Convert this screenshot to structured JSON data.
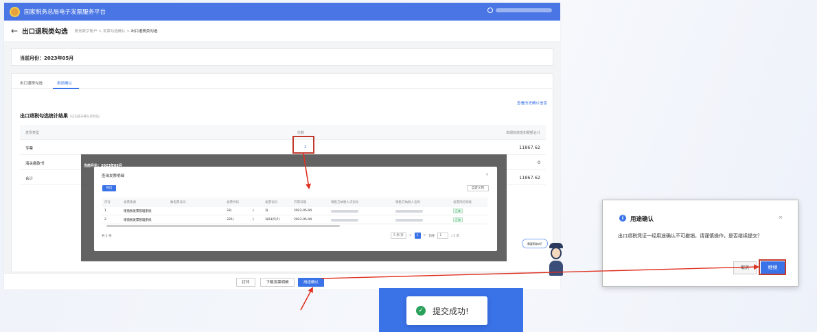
{
  "header": {
    "platform_title": "国家税务总局电子发票服务平台"
  },
  "page": {
    "back_icon": "←",
    "title": "出口退税类勾选",
    "breadcrumb": [
      "税务数字账户",
      "发票勾选确认",
      "出口退税类勾选"
    ],
    "crumb_sep": ">"
  },
  "month_label": "当前月份：2023年05月",
  "tabs": [
    "出口退税勾选",
    "用途确认"
  ],
  "history_link": "查看历史确认信息",
  "section": {
    "title": "出口退税勾选统计结果",
    "subtitle": "(已勾选未确认的凭证)"
  },
  "stats_table": {
    "headers": [
      "发票类型",
      "份数",
      "本期有效抵扣税额合计"
    ],
    "rows": [
      {
        "type": "专票",
        "count": "2",
        "amount": "11867.62"
      },
      {
        "type": "海关缴款书",
        "count": "",
        "amount": "0"
      },
      {
        "type": "合计",
        "count": "",
        "amount": "11867.62"
      }
    ]
  },
  "overlay": {
    "month": "当前月份：2023年05月"
  },
  "query_dialog": {
    "title": "查询发票明细",
    "close": "×",
    "export_label": "导出",
    "columns_label": "自定义列",
    "headers": [
      "序号",
      "发票来源",
      "数电票号码",
      "发票代码",
      "发票号码",
      "开票日期",
      "销售方纳税人识别号",
      "销售方纳税人名称",
      "发票风险等级"
    ],
    "rows": [
      {
        "no": "1",
        "source": "增值税发票管理系统",
        "code": "33(",
        "code2": ")",
        "num": "3(",
        "date": "2023-05-04",
        "status": "正常"
      },
      {
        "no": "2",
        "source": "增值税发票管理系统",
        "code": "335(",
        "code2": ")",
        "num": "3(03(5)7(",
        "date": "2023-05-04",
        "status": "正常"
      }
    ],
    "total": "共 2 条",
    "page_size": "5 条/页",
    "prev": "<",
    "current_page": "1",
    "next": ">",
    "goto_label": "前往",
    "goto_value": "1",
    "page_count": "/ 1 页"
  },
  "bottom_buttons": {
    "print": "打印",
    "download": "下载发票明细",
    "confirm": "用途确认"
  },
  "helper_bubble": "需要帮助吗?",
  "confirm_dialog": {
    "icon": "i",
    "title": "用途确认",
    "close": "×",
    "message": "出口退税凭证一经用途确认不可撤销，请谨慎操作，是否继续提交？",
    "cancel": "取消",
    "ok": "继续"
  },
  "success_toast": {
    "icon": "✓",
    "text": "提交成功!"
  },
  "colors": {
    "accent": "#3a72e8",
    "header": "#4a76e5",
    "arrow": "#e03020",
    "success": "#2aa15a"
  }
}
